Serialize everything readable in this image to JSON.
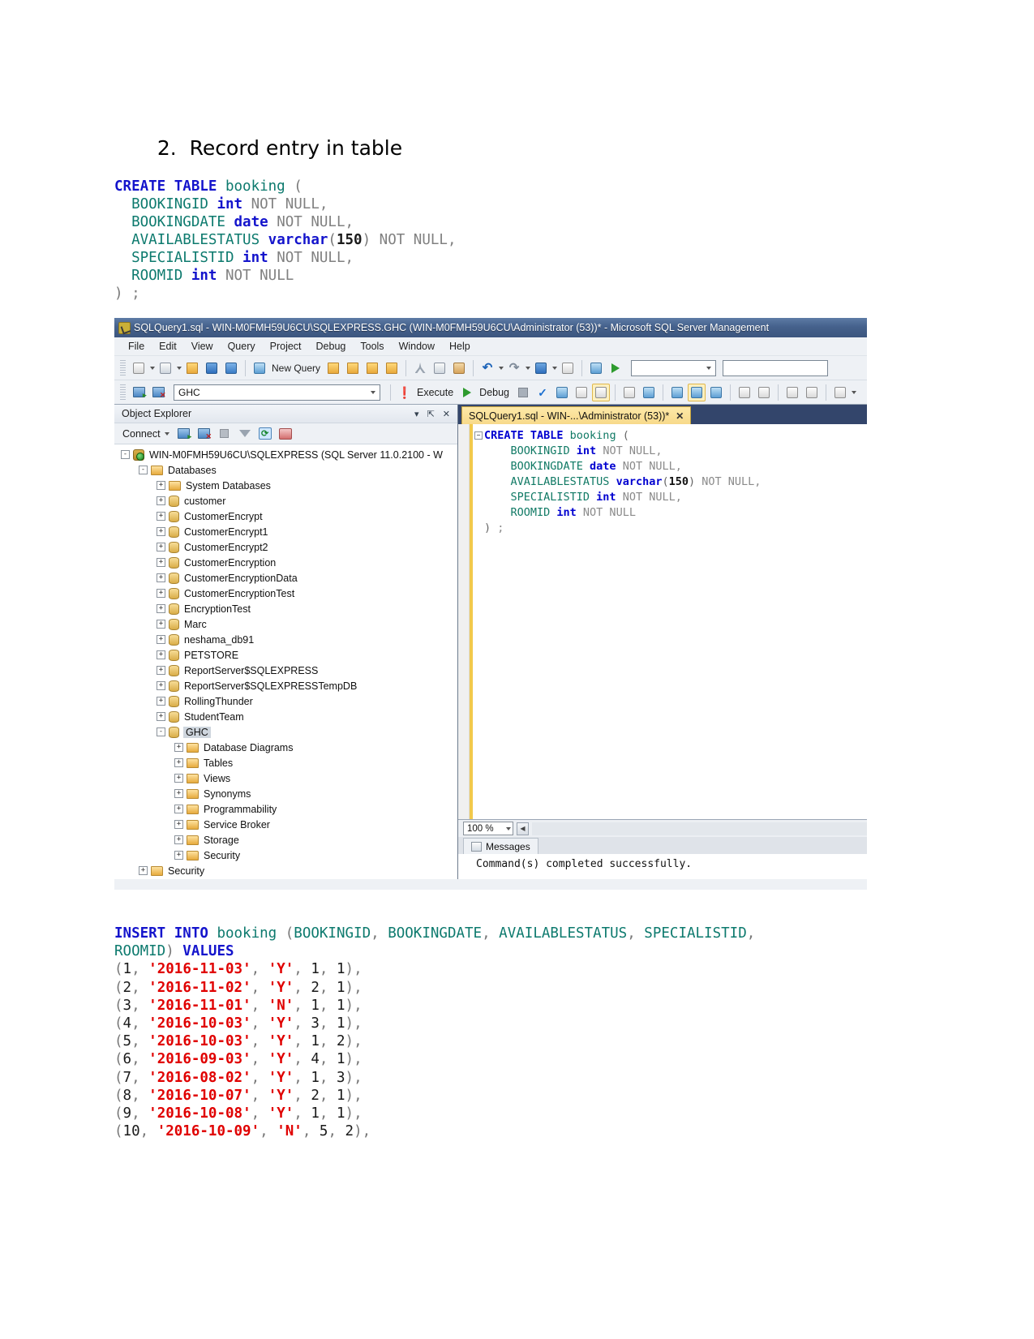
{
  "document": {
    "heading_number": "2.",
    "heading_text": "Record entry in table",
    "create_table_code": [
      [
        {
          "t": "CREATE TABLE ",
          "c": "k-blue"
        },
        {
          "t": "booking",
          "c": "k-teal"
        },
        {
          "t": " (",
          "c": "k-paren"
        }
      ],
      [
        {
          "t": "  BOOKINGID ",
          "c": "k-teal"
        },
        {
          "t": "int",
          "c": "k-blue"
        },
        {
          "t": " NOT NULL,",
          "c": "k-gray"
        }
      ],
      [
        {
          "t": "  BOOKINGDATE ",
          "c": "k-teal"
        },
        {
          "t": "date",
          "c": "k-blue"
        },
        {
          "t": " NOT NULL,",
          "c": "k-gray"
        }
      ],
      [
        {
          "t": "  AVAILABLESTATUS ",
          "c": "k-teal"
        },
        {
          "t": "varchar",
          "c": "k-blue"
        },
        {
          "t": "(",
          "c": "k-paren"
        },
        {
          "t": "150",
          "c": "k-black"
        },
        {
          "t": ")",
          "c": "k-paren"
        },
        {
          "t": " NOT NULL,",
          "c": "k-gray"
        }
      ],
      [
        {
          "t": "  SPECIALISTID ",
          "c": "k-teal"
        },
        {
          "t": "int",
          "c": "k-blue"
        },
        {
          "t": " NOT NULL,",
          "c": "k-gray"
        }
      ],
      [
        {
          "t": "  ROOMID ",
          "c": "k-teal"
        },
        {
          "t": "int",
          "c": "k-blue"
        },
        {
          "t": " NOT NULL",
          "c": "k-gray"
        }
      ],
      [
        {
          "t": ") ",
          "c": "k-paren"
        },
        {
          "t": ";",
          "c": "k-gray"
        }
      ]
    ],
    "insert_code": [
      [
        {
          "t": "INSERT INTO ",
          "c": "k-blue"
        },
        {
          "t": "booking",
          "c": "k-teal"
        },
        {
          "t": " (",
          "c": "k-paren"
        },
        {
          "t": "BOOKINGID",
          "c": "k-teal"
        },
        {
          "t": ", ",
          "c": "k-paren"
        },
        {
          "t": "BOOKINGDATE",
          "c": "k-teal"
        },
        {
          "t": ", ",
          "c": "k-paren"
        },
        {
          "t": "AVAILABLESTATUS",
          "c": "k-teal"
        },
        {
          "t": ", ",
          "c": "k-paren"
        },
        {
          "t": "SPECIALISTID",
          "c": "k-teal"
        },
        {
          "t": ",",
          "c": "k-paren"
        }
      ],
      [
        {
          "t": "ROOMID",
          "c": "k-teal"
        },
        {
          "t": ") ",
          "c": "k-paren"
        },
        {
          "t": "VALUES",
          "c": "k-blue"
        }
      ],
      [
        {
          "t": "(",
          "c": "k-paren"
        },
        {
          "t": "1",
          "c": "k-num"
        },
        {
          "t": ", ",
          "c": "k-paren"
        },
        {
          "t": "'2016-11-03'",
          "c": "k-red"
        },
        {
          "t": ", ",
          "c": "k-paren"
        },
        {
          "t": "'Y'",
          "c": "k-red"
        },
        {
          "t": ", ",
          "c": "k-paren"
        },
        {
          "t": "1",
          "c": "k-num"
        },
        {
          "t": ", ",
          "c": "k-paren"
        },
        {
          "t": "1",
          "c": "k-num"
        },
        {
          "t": "),",
          "c": "k-paren"
        }
      ],
      [
        {
          "t": "(",
          "c": "k-paren"
        },
        {
          "t": "2",
          "c": "k-num"
        },
        {
          "t": ", ",
          "c": "k-paren"
        },
        {
          "t": "'2016-11-02'",
          "c": "k-red"
        },
        {
          "t": ", ",
          "c": "k-paren"
        },
        {
          "t": "'Y'",
          "c": "k-red"
        },
        {
          "t": ", ",
          "c": "k-paren"
        },
        {
          "t": "2",
          "c": "k-num"
        },
        {
          "t": ", ",
          "c": "k-paren"
        },
        {
          "t": "1",
          "c": "k-num"
        },
        {
          "t": "),",
          "c": "k-paren"
        }
      ],
      [
        {
          "t": "(",
          "c": "k-paren"
        },
        {
          "t": "3",
          "c": "k-num"
        },
        {
          "t": ", ",
          "c": "k-paren"
        },
        {
          "t": "'2016-11-01'",
          "c": "k-red"
        },
        {
          "t": ", ",
          "c": "k-paren"
        },
        {
          "t": "'N'",
          "c": "k-red"
        },
        {
          "t": ", ",
          "c": "k-paren"
        },
        {
          "t": "1",
          "c": "k-num"
        },
        {
          "t": ", ",
          "c": "k-paren"
        },
        {
          "t": "1",
          "c": "k-num"
        },
        {
          "t": "),",
          "c": "k-paren"
        }
      ],
      [
        {
          "t": "(",
          "c": "k-paren"
        },
        {
          "t": "4",
          "c": "k-num"
        },
        {
          "t": ", ",
          "c": "k-paren"
        },
        {
          "t": "'2016-10-03'",
          "c": "k-red"
        },
        {
          "t": ", ",
          "c": "k-paren"
        },
        {
          "t": "'Y'",
          "c": "k-red"
        },
        {
          "t": ", ",
          "c": "k-paren"
        },
        {
          "t": "3",
          "c": "k-num"
        },
        {
          "t": ", ",
          "c": "k-paren"
        },
        {
          "t": "1",
          "c": "k-num"
        },
        {
          "t": "),",
          "c": "k-paren"
        }
      ],
      [
        {
          "t": "(",
          "c": "k-paren"
        },
        {
          "t": "5",
          "c": "k-num"
        },
        {
          "t": ", ",
          "c": "k-paren"
        },
        {
          "t": "'2016-10-03'",
          "c": "k-red"
        },
        {
          "t": ", ",
          "c": "k-paren"
        },
        {
          "t": "'Y'",
          "c": "k-red"
        },
        {
          "t": ", ",
          "c": "k-paren"
        },
        {
          "t": "1",
          "c": "k-num"
        },
        {
          "t": ", ",
          "c": "k-paren"
        },
        {
          "t": "2",
          "c": "k-num"
        },
        {
          "t": "),",
          "c": "k-paren"
        }
      ],
      [
        {
          "t": "(",
          "c": "k-paren"
        },
        {
          "t": "6",
          "c": "k-num"
        },
        {
          "t": ", ",
          "c": "k-paren"
        },
        {
          "t": "'2016-09-03'",
          "c": "k-red"
        },
        {
          "t": ", ",
          "c": "k-paren"
        },
        {
          "t": "'Y'",
          "c": "k-red"
        },
        {
          "t": ", ",
          "c": "k-paren"
        },
        {
          "t": "4",
          "c": "k-num"
        },
        {
          "t": ", ",
          "c": "k-paren"
        },
        {
          "t": "1",
          "c": "k-num"
        },
        {
          "t": "),",
          "c": "k-paren"
        }
      ],
      [
        {
          "t": "(",
          "c": "k-paren"
        },
        {
          "t": "7",
          "c": "k-num"
        },
        {
          "t": ", ",
          "c": "k-paren"
        },
        {
          "t": "'2016-08-02'",
          "c": "k-red"
        },
        {
          "t": ", ",
          "c": "k-paren"
        },
        {
          "t": "'Y'",
          "c": "k-red"
        },
        {
          "t": ", ",
          "c": "k-paren"
        },
        {
          "t": "1",
          "c": "k-num"
        },
        {
          "t": ", ",
          "c": "k-paren"
        },
        {
          "t": "3",
          "c": "k-num"
        },
        {
          "t": "),",
          "c": "k-paren"
        }
      ],
      [
        {
          "t": "(",
          "c": "k-paren"
        },
        {
          "t": "8",
          "c": "k-num"
        },
        {
          "t": ", ",
          "c": "k-paren"
        },
        {
          "t": "'2016-10-07'",
          "c": "k-red"
        },
        {
          "t": ", ",
          "c": "k-paren"
        },
        {
          "t": "'Y'",
          "c": "k-red"
        },
        {
          "t": ", ",
          "c": "k-paren"
        },
        {
          "t": "2",
          "c": "k-num"
        },
        {
          "t": ", ",
          "c": "k-paren"
        },
        {
          "t": "1",
          "c": "k-num"
        },
        {
          "t": "),",
          "c": "k-paren"
        }
      ],
      [
        {
          "t": "(",
          "c": "k-paren"
        },
        {
          "t": "9",
          "c": "k-num"
        },
        {
          "t": ", ",
          "c": "k-paren"
        },
        {
          "t": "'2016-10-08'",
          "c": "k-red"
        },
        {
          "t": ", ",
          "c": "k-paren"
        },
        {
          "t": "'Y'",
          "c": "k-red"
        },
        {
          "t": ", ",
          "c": "k-paren"
        },
        {
          "t": "1",
          "c": "k-num"
        },
        {
          "t": ", ",
          "c": "k-paren"
        },
        {
          "t": "1",
          "c": "k-num"
        },
        {
          "t": "),",
          "c": "k-paren"
        }
      ],
      [
        {
          "t": "(",
          "c": "k-paren"
        },
        {
          "t": "10",
          "c": "k-num"
        },
        {
          "t": ", ",
          "c": "k-paren"
        },
        {
          "t": "'2016-10-09'",
          "c": "k-red"
        },
        {
          "t": ", ",
          "c": "k-paren"
        },
        {
          "t": "'N'",
          "c": "k-red"
        },
        {
          "t": ", ",
          "c": "k-paren"
        },
        {
          "t": "5",
          "c": "k-num"
        },
        {
          "t": ", ",
          "c": "k-paren"
        },
        {
          "t": "2",
          "c": "k-num"
        },
        {
          "t": "),",
          "c": "k-paren"
        }
      ]
    ]
  },
  "ssms": {
    "title": "SQLQuery1.sql - WIN-M0FMH59U6CU\\SQLEXPRESS.GHC (WIN-M0FMH59U6CU\\Administrator (53))* - Microsoft SQL Server Management",
    "menu": [
      "File",
      "Edit",
      "View",
      "Query",
      "Project",
      "Debug",
      "Tools",
      "Window",
      "Help"
    ],
    "toolbar": {
      "new_query_label": "New Query",
      "database_value": "GHC",
      "execute_label": "Execute",
      "debug_label": "Debug"
    },
    "object_explorer": {
      "title": "Object Explorer",
      "connect_label": "Connect",
      "tree": [
        {
          "label": "WIN-M0FMH59U6CU\\SQLEXPRESS (SQL Server 11.0.2100 - W",
          "indent": 0,
          "expander": "-",
          "icon": "server-icon",
          "selected": false
        },
        {
          "label": "Databases",
          "indent": 1,
          "expander": "-",
          "icon": "folder-icon",
          "selected": false
        },
        {
          "label": "System Databases",
          "indent": 2,
          "expander": "+",
          "icon": "folder-icon",
          "selected": false
        },
        {
          "label": "customer",
          "indent": 2,
          "expander": "+",
          "icon": "database-icon",
          "selected": false
        },
        {
          "label": "CustomerEncrypt",
          "indent": 2,
          "expander": "+",
          "icon": "database-icon",
          "selected": false
        },
        {
          "label": "CustomerEncrypt1",
          "indent": 2,
          "expander": "+",
          "icon": "database-icon",
          "selected": false
        },
        {
          "label": "CustomerEncrypt2",
          "indent": 2,
          "expander": "+",
          "icon": "database-icon",
          "selected": false
        },
        {
          "label": "CustomerEncryption",
          "indent": 2,
          "expander": "+",
          "icon": "database-icon",
          "selected": false
        },
        {
          "label": "CustomerEncryptionData",
          "indent": 2,
          "expander": "+",
          "icon": "database-icon",
          "selected": false
        },
        {
          "label": "CustomerEncryptionTest",
          "indent": 2,
          "expander": "+",
          "icon": "database-icon",
          "selected": false
        },
        {
          "label": "EncryptionTest",
          "indent": 2,
          "expander": "+",
          "icon": "database-icon",
          "selected": false
        },
        {
          "label": "Marc",
          "indent": 2,
          "expander": "+",
          "icon": "database-icon",
          "selected": false
        },
        {
          "label": "neshama_db91",
          "indent": 2,
          "expander": "+",
          "icon": "database-icon",
          "selected": false
        },
        {
          "label": "PETSTORE",
          "indent": 2,
          "expander": "+",
          "icon": "database-icon",
          "selected": false
        },
        {
          "label": "ReportServer$SQLEXPRESS",
          "indent": 2,
          "expander": "+",
          "icon": "database-icon",
          "selected": false
        },
        {
          "label": "ReportServer$SQLEXPRESSTempDB",
          "indent": 2,
          "expander": "+",
          "icon": "database-icon",
          "selected": false
        },
        {
          "label": "RollingThunder",
          "indent": 2,
          "expander": "+",
          "icon": "database-icon",
          "selected": false
        },
        {
          "label": "StudentTeam",
          "indent": 2,
          "expander": "+",
          "icon": "database-icon",
          "selected": false
        },
        {
          "label": "GHC",
          "indent": 2,
          "expander": "-",
          "icon": "database-icon",
          "selected": true
        },
        {
          "label": "Database Diagrams",
          "indent": 3,
          "expander": "+",
          "icon": "folder-icon",
          "selected": false
        },
        {
          "label": "Tables",
          "indent": 3,
          "expander": "+",
          "icon": "folder-icon",
          "selected": false
        },
        {
          "label": "Views",
          "indent": 3,
          "expander": "+",
          "icon": "folder-icon",
          "selected": false
        },
        {
          "label": "Synonyms",
          "indent": 3,
          "expander": "+",
          "icon": "folder-icon",
          "selected": false
        },
        {
          "label": "Programmability",
          "indent": 3,
          "expander": "+",
          "icon": "folder-icon",
          "selected": false
        },
        {
          "label": "Service Broker",
          "indent": 3,
          "expander": "+",
          "icon": "folder-icon",
          "selected": false
        },
        {
          "label": "Storage",
          "indent": 3,
          "expander": "+",
          "icon": "folder-icon",
          "selected": false
        },
        {
          "label": "Security",
          "indent": 3,
          "expander": "+",
          "icon": "folder-icon",
          "selected": false
        },
        {
          "label": "Security",
          "indent": 1,
          "expander": "+",
          "icon": "folder-icon",
          "selected": false
        }
      ]
    },
    "editor": {
      "tab_label": "SQLQuery1.sql - WIN-...\\Administrator (53))*",
      "code": [
        [
          {
            "t": "CREATE TABLE ",
            "c": "e-blue"
          },
          {
            "t": "booking",
            "c": "e-teal"
          },
          {
            "t": " (",
            "c": "e-pl"
          }
        ],
        [
          {
            "t": "    BOOKINGID ",
            "c": "e-teal"
          },
          {
            "t": "int",
            "c": "e-blue"
          },
          {
            "t": " NOT NULL,",
            "c": "e-gray"
          }
        ],
        [
          {
            "t": "    BOOKINGDATE ",
            "c": "e-teal"
          },
          {
            "t": "date",
            "c": "e-blue"
          },
          {
            "t": " NOT NULL,",
            "c": "e-gray"
          }
        ],
        [
          {
            "t": "    AVAILABLESTATUS ",
            "c": "e-teal"
          },
          {
            "t": "varchar",
            "c": "e-blue"
          },
          {
            "t": "(",
            "c": "e-pl"
          },
          {
            "t": "150",
            "c": "e-blk"
          },
          {
            "t": ")",
            "c": "e-pl"
          },
          {
            "t": " NOT NULL,",
            "c": "e-gray"
          }
        ],
        [
          {
            "t": "    SPECIALISTID ",
            "c": "e-teal"
          },
          {
            "t": "int",
            "c": "e-blue"
          },
          {
            "t": " NOT NULL,",
            "c": "e-gray"
          }
        ],
        [
          {
            "t": "    ROOMID ",
            "c": "e-teal"
          },
          {
            "t": "int",
            "c": "e-blue"
          },
          {
            "t": " NOT NULL",
            "c": "e-gray"
          }
        ],
        [
          {
            "t": ") ",
            "c": "e-pl"
          },
          {
            "t": ";",
            "c": "e-gray"
          }
        ]
      ],
      "zoom_level": "100 %"
    },
    "messages": {
      "tab_label": "Messages",
      "text": "Command(s) completed successfully."
    }
  }
}
